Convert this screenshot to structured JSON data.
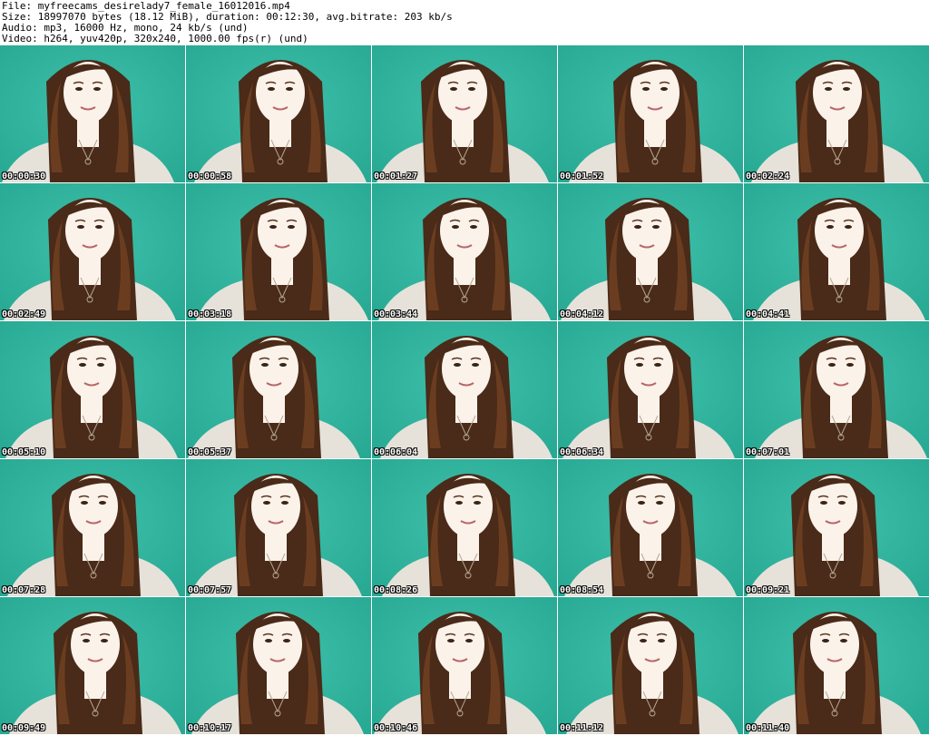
{
  "header": {
    "file": "File: myfreecams_desirelady7_female_16012016.mp4",
    "size": "Size: 18997070 bytes (18.12 MiB), duration: 00:12:30, avg.bitrate: 203 kb/s",
    "audio": "Audio: mp3, 16000 Hz, mono, 24 kb/s (und)",
    "video": "Video: h264, yuv420p, 320x240, 1000.00 fps(r) (und)"
  },
  "thumbnails": [
    {
      "time": "00:00:30"
    },
    {
      "time": "00:00:58"
    },
    {
      "time": "00:01:27"
    },
    {
      "time": "00:01:52"
    },
    {
      "time": "00:02:24"
    },
    {
      "time": "00:02:49"
    },
    {
      "time": "00:03:18"
    },
    {
      "time": "00:03:44"
    },
    {
      "time": "00:04:12"
    },
    {
      "time": "00:04:41"
    },
    {
      "time": "00:05:10"
    },
    {
      "time": "00:05:37"
    },
    {
      "time": "00:06:04"
    },
    {
      "time": "00:06:34"
    },
    {
      "time": "00:07:01"
    },
    {
      "time": "00:07:28"
    },
    {
      "time": "00:07:57"
    },
    {
      "time": "00:08:26"
    },
    {
      "time": "00:08:54"
    },
    {
      "time": "00:09:21"
    },
    {
      "time": "00:09:49"
    },
    {
      "time": "00:10:17"
    },
    {
      "time": "00:10:46"
    },
    {
      "time": "00:11:12"
    },
    {
      "time": "00:11:40"
    }
  ],
  "colors": {
    "background": "#27a993",
    "hair": "#4a2a18",
    "skin": "#fbf2ea",
    "shirt": "#e6e2da"
  }
}
